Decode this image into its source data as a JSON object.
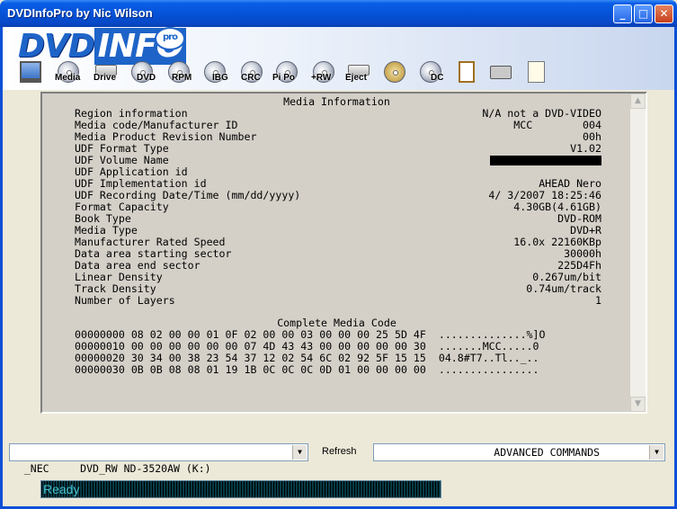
{
  "window": {
    "title": "DVDInfoPro by Nic Wilson",
    "minimize_glyph": "_",
    "maximize_glyph": "□",
    "close_glyph": "✕"
  },
  "logo": {
    "dvd": "DVD",
    "info": "INFO",
    "pro": "pro"
  },
  "toolbar": [
    {
      "label": "",
      "icon": "monitor-icon"
    },
    {
      "label": "Media",
      "icon": "disc-icon"
    },
    {
      "label": "Drive",
      "icon": "drive-icon"
    },
    {
      "label": "DVD",
      "icon": "disc-icon"
    },
    {
      "label": "RPM",
      "icon": "disc-icon"
    },
    {
      "label": "IBG",
      "icon": "disc-icon"
    },
    {
      "label": "CRC",
      "icon": "disc-icon"
    },
    {
      "label": "Pi Po",
      "icon": "disc-icon"
    },
    {
      "label": "+RW",
      "icon": "disc-icon"
    },
    {
      "label": "Eject",
      "icon": "eject-icon"
    },
    {
      "label": "",
      "icon": "wrench-icon"
    },
    {
      "label": "DC",
      "icon": "disc-icon"
    },
    {
      "label": "",
      "icon": "clipboard-icon"
    },
    {
      "label": "",
      "icon": "camera-icon"
    },
    {
      "label": "",
      "icon": "notepad-icon"
    }
  ],
  "media_info": {
    "heading": "Media Information",
    "rows": [
      {
        "label": "Region information",
        "value": "N/A not a DVD-VIDEO"
      },
      {
        "label": "Media code/Manufacturer ID",
        "value": "MCC        004"
      },
      {
        "label": "Media Product Revision Number",
        "value": "00h"
      },
      {
        "label": "UDF Format Type",
        "value": "V1.02"
      },
      {
        "label": "UDF Volume Name",
        "value": ""
      },
      {
        "label": "UDF Application id",
        "value": ""
      },
      {
        "label": "UDF Implementation id",
        "value": "AHEAD Nero"
      },
      {
        "label": "UDF Recording Date/Time (mm/dd/yyyy)",
        "value": "4/ 3/2007 18:25:46"
      },
      {
        "label": "Format Capacity",
        "value": "4.30GB(4.61GB)"
      },
      {
        "label": "Book Type",
        "value": "DVD-ROM"
      },
      {
        "label": "Media Type",
        "value": "DVD+R"
      },
      {
        "label": "Manufacturer Rated Speed",
        "value": "16.0x 22160KBp"
      },
      {
        "label": "Data area starting sector",
        "value": "30000h"
      },
      {
        "label": "Data area end sector",
        "value": "225D4Fh"
      },
      {
        "label": "Linear Density",
        "value": "0.267um/bit"
      },
      {
        "label": "Track Density",
        "value": "0.74um/track"
      },
      {
        "label": "Number of Layers",
        "value": "1"
      }
    ]
  },
  "media_code": {
    "heading": "Complete Media Code",
    "lines": [
      "00000000 08 02 00 00 01 0F 02 00 00 03 00 00 00 25 5D 4F  ..............%]O",
      "00000010 00 00 00 00 00 00 07 4D 43 43 00 00 00 00 00 30  .......MCC.....0",
      "00000020 30 34 00 38 23 54 37 12 02 54 6C 02 92 5F 15 15  04.8#T7..Tl.._..",
      "00000030 0B 0B 08 08 01 19 1B 0C 0C 0C 0D 01 00 00 00 00  ................"
    ]
  },
  "scroll": {
    "up_glyph": "▲",
    "down_glyph": "▼"
  },
  "drive_select": {
    "value": "_NEC     DVD_RW ND-3520AW (K:)",
    "arrow": "▼"
  },
  "refresh_label": "Refresh",
  "commands_select": {
    "value": "ADVANCED COMMANDS",
    "arrow": "▼"
  },
  "status": {
    "text": "Ready"
  }
}
